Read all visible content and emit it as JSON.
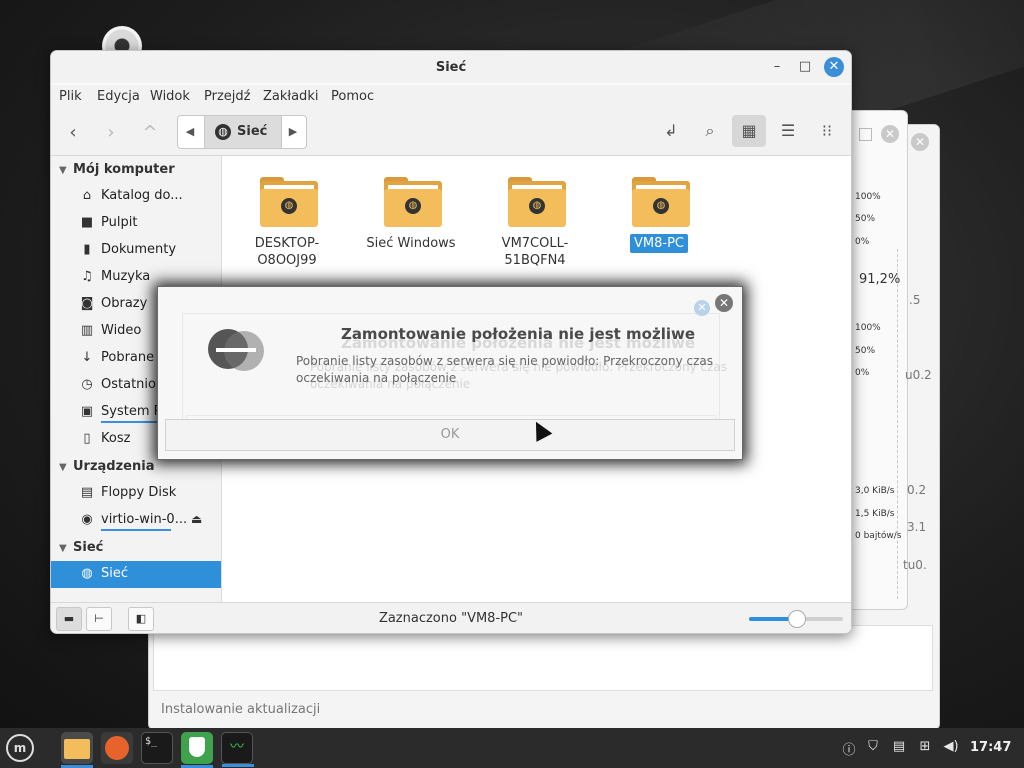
{
  "background": {
    "stats": {
      "percent_top": [
        "100%",
        "50%",
        "0%"
      ],
      "big_value": "91,2%",
      "percent_mid": [
        "100%",
        "50%",
        "0%"
      ],
      "rates": [
        "3,0 KiB/s",
        "1,5 KiB/s",
        "0 bajtów/s"
      ],
      "cut_labels": [
        ".5",
        "u0.2",
        "0.2",
        "3.1",
        "tu0."
      ]
    },
    "update_status": "Instalowanie aktualizacji"
  },
  "window": {
    "title": "Sieć",
    "menu": [
      "Plik",
      "Edycja",
      "Widok",
      "Przejdź",
      "Zakładki",
      "Pomoc"
    ],
    "path": {
      "crumb": "Sieć"
    },
    "sidebar": {
      "sections": [
        {
          "title": "Mój komputer",
          "items": [
            {
              "label": "Katalog do...",
              "icon": "home-icon"
            },
            {
              "label": "Pulpit",
              "icon": "desktop-icon"
            },
            {
              "label": "Dokumenty",
              "icon": "documents-icon"
            },
            {
              "label": "Muzyka",
              "icon": "music-icon"
            },
            {
              "label": "Obrazy",
              "icon": "camera-icon"
            },
            {
              "label": "Wideo",
              "icon": "film-icon"
            },
            {
              "label": "Pobrane",
              "icon": "download-icon"
            },
            {
              "label": "Ostatnio o",
              "icon": "clock-icon"
            },
            {
              "label": "System Pl",
              "icon": "drive-icon"
            },
            {
              "label": "Kosz",
              "icon": "trash-icon"
            }
          ]
        },
        {
          "title": "Urządzenia",
          "items": [
            {
              "label": "Floppy Disk",
              "icon": "floppy-icon"
            },
            {
              "label": "virtio-win-0...",
              "icon": "disc-icon"
            }
          ]
        },
        {
          "title": "Sieć",
          "items": [
            {
              "label": "Sieć",
              "icon": "network-globe-icon"
            }
          ]
        }
      ]
    },
    "files": [
      {
        "name_l1": "DESKTOP-",
        "name_l2": "O8OOJ99"
      },
      {
        "name_l1": "Sieć Windows",
        "name_l2": ""
      },
      {
        "name_l1": "VM7COLL-",
        "name_l2": "51BQFN4"
      },
      {
        "name_l1": "VM8-PC",
        "name_l2": ""
      }
    ],
    "status_text": "Zaznaczono \"VM8-PC\"",
    "zoom_level": 0.5
  },
  "dialog": {
    "title": "Zamontowanie położenia nie jest możliwe",
    "message": "Pobranie listy zasobów z serwera się nie powiodło: Przekroczony czas oczekiwania na połączenie",
    "ok_label": "OK"
  },
  "taskbar": {
    "clock": "17:47"
  },
  "colors": {
    "accent": "#2f90d9",
    "folder": "#f4bd5b"
  }
}
